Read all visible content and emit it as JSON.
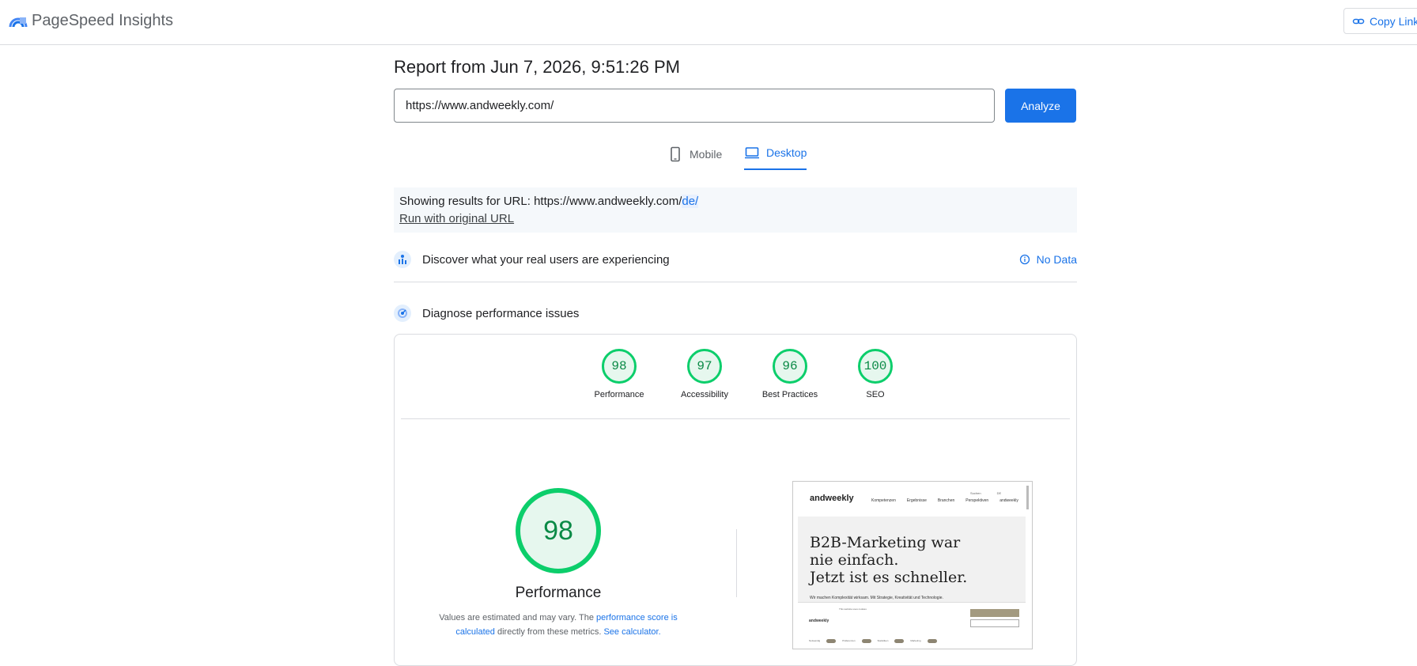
{
  "header": {
    "brand": "PageSpeed Insights",
    "copy_link": "Copy Link"
  },
  "report": {
    "title": "Report from Jun 7, 2026, 9:51:26 PM"
  },
  "search": {
    "value": "https://www.andweekly.com/",
    "analyze_label": "Analyze"
  },
  "tabs": [
    {
      "label": "Mobile",
      "active": false,
      "icon": "phone-icon"
    },
    {
      "label": "Desktop",
      "active": true,
      "icon": "laptop-icon"
    }
  ],
  "notice": {
    "prefix": "Showing results for URL: https://www.andweekly.com/",
    "highlight": "de/",
    "run_original": "Run with original URL"
  },
  "real_users": {
    "title": "Discover what your real users are experiencing",
    "no_data": "No Data"
  },
  "diagnose": {
    "title": "Diagnose performance issues"
  },
  "scores": [
    {
      "value": "98",
      "label": "Performance"
    },
    {
      "value": "97",
      "label": "Accessibility"
    },
    {
      "value": "96",
      "label": "Best Practices"
    },
    {
      "value": "100",
      "label": "SEO"
    }
  ],
  "performance": {
    "score": "98",
    "label": "Performance",
    "note_1": "Values are estimated and may vary. The ",
    "note_link_1": "performance score is calculated",
    "note_2": " directly from these metrics. ",
    "note_link_2": "See calculator."
  },
  "thumbnail": {
    "logo": "andweekly",
    "nav": [
      "Kompetenzen",
      "Ergebnisse",
      "Branchen",
      "Perspektiven",
      "andweekly"
    ],
    "top_right": [
      "Suchen",
      "DE",
      "EN"
    ],
    "headline_1": "B2B-Marketing war",
    "headline_2": "nie einfach.",
    "headline_3": "Jetzt ist es schneller.",
    "subline": "Wir machen Komplexität wirksam. Mit Strategie, Kreativität und Technologie.",
    "banner_logo": "andweekly",
    "banner_title": "This website uses cookies",
    "toggles": [
      "Notwendig",
      "Präferenzen",
      "Statistiken",
      "Marketing"
    ]
  },
  "colors": {
    "accent": "#1a73e8",
    "score_good": "#0cce6b"
  }
}
